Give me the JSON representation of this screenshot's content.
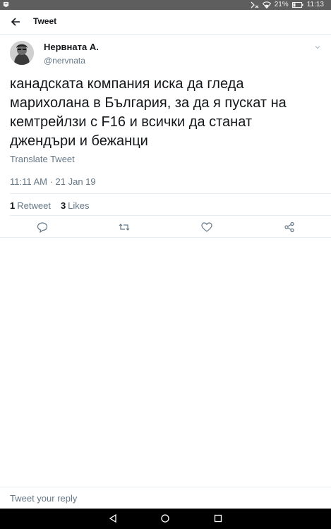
{
  "status_bar": {
    "battery_percent": "21%",
    "time": "11:13",
    "icons": [
      "notification-icon",
      "mute-icon",
      "wifi-icon",
      "battery-icon"
    ]
  },
  "app_bar": {
    "title": "Tweet",
    "back_icon": "back-arrow-icon"
  },
  "tweet": {
    "author_name": "Нервната А.",
    "author_handle": "@nervnata",
    "text_lines": [
      "канадската компания иска да гледа",
      "марихолана в България, за да я пускат на",
      "кемтрейлзи с F16 и всички да станат",
      "джендъри и бежанци"
    ],
    "translate_label": "Translate Tweet",
    "timestamp": "11:11 AM · 21 Jan 19",
    "stats": {
      "retweets_count": "1",
      "retweets_label": "Retweet",
      "likes_count": "3",
      "likes_label": "Likes"
    },
    "actions": [
      "reply-icon",
      "retweet-icon",
      "like-icon",
      "share-icon"
    ]
  },
  "reply": {
    "placeholder": "Tweet your reply"
  },
  "nav_bar": {
    "buttons": [
      "back-triangle-icon",
      "home-circle-icon",
      "recents-square-icon"
    ]
  },
  "colors": {
    "text_primary": "#14171a",
    "text_secondary": "#657786",
    "divider": "#e6ecf0",
    "status_bar": "#5e5e5e",
    "nav_bar": "#000000"
  }
}
